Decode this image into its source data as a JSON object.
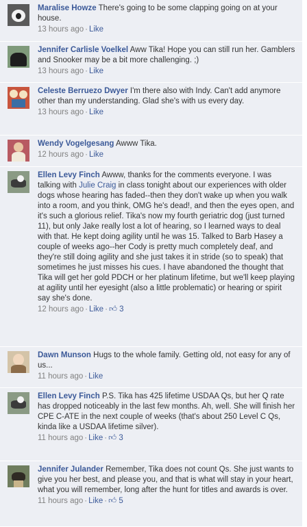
{
  "comments": [
    {
      "name": "Maralise Howze",
      "text": "There's going to be some clapping going on at your house.",
      "time": "13 hours ago",
      "like": "Like"
    },
    {
      "name": "Jennifer Carlisle Voelkel",
      "text": "Aww Tika! Hope you can still run her. Gamblers and Snooker may be a bit more challenging. ;)",
      "time": "13 hours ago",
      "like": "Like"
    },
    {
      "name": "Celeste Berruezo Dwyer",
      "text": "I'm there also with Indy. Can't add anymore other than my understanding. Glad she's with us every day.",
      "time": "13 hours ago",
      "like": "Like"
    },
    {
      "name": "Wendy Vogelgesang",
      "text": "Awww Tika.",
      "time": "12 hours ago",
      "like": "Like"
    },
    {
      "name": "Ellen Levy Finch",
      "text_a": "Awww, thanks for the comments everyone. I was talking with",
      "mention": "Julie Craig",
      "text_b": "in class tonight about our experiences with older dogs whose hearing has faded--then they don't wake up when you walk into a room, and you think, OMG he's dead!, and then the eyes open, and it's such a glorious relief. Tika's now my fourth geriatric dog (just turned 11), but only Jake really lost a lot of hearing, so I learned ways to deal with that. He kept doing agility until he was 15. Talked to Barb Hasey a couple of weeks ago--her Cody is pretty much completely deaf, and they're still doing agility and she just takes it in stride (so to speak) that sometimes he just misses his cues. I have abandoned the thought that Tika will get her gold PDCH or her platinum lifetime, but we'll keep playing at agility until her eyesight (also a little problematic) or hearing or spirit say she's done.",
      "time": "12 hours ago",
      "like": "Like",
      "likes": "3"
    },
    {
      "name": "Dawn Munson",
      "text": "Hugs to the whole family. Getting old, not easy for any of us...",
      "time": "11 hours ago",
      "like": "Like"
    },
    {
      "name": "Ellen Levy Finch",
      "text": "P.S. Tika has 425 lifetime USDAA Qs, but her Q rate has dropped noticeably in the last few months. Ah, well. She will finish her CPE C-ATE in the next couple of weeks (that's about 250 Level C Qs, kinda like a USDAA lifetime silver).",
      "time": "11 hours ago",
      "like": "Like",
      "likes": "3"
    },
    {
      "name": "Jennifer Julander",
      "text": "Remember, Tika does not count Qs. She just wants to give you her best, and please you, and that is what will stay in your heart, what you will remember, long after the hunt for titles and awards is over.",
      "time": "11 hours ago",
      "like": "Like",
      "likes": "5"
    }
  ],
  "icons": {
    "like_count": "thumbs-up-icon"
  },
  "colors": {
    "name": "#3b5998",
    "background": "#edeff4",
    "meta": "#808080"
  }
}
